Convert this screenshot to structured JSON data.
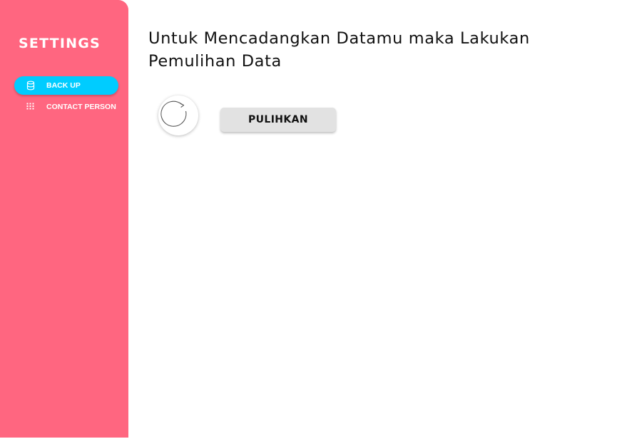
{
  "sidebar": {
    "title": "SETTINGS",
    "items": [
      {
        "label": "BACK UP",
        "icon": "database-icon",
        "active": true
      },
      {
        "label": "CONTACT PERSON",
        "icon": "grid-dots-icon",
        "active": false
      }
    ]
  },
  "main": {
    "title": "Untuk Mencadangkan Datamu maka Lakukan Pemulihan Data",
    "restore_icon": "refresh-icon",
    "restore_button_label": "PULIHKAN"
  },
  "colors": {
    "sidebar_bg": "#ff6680",
    "active_item_bg": "#00ccff",
    "button_bg": "#e2e2e2"
  }
}
